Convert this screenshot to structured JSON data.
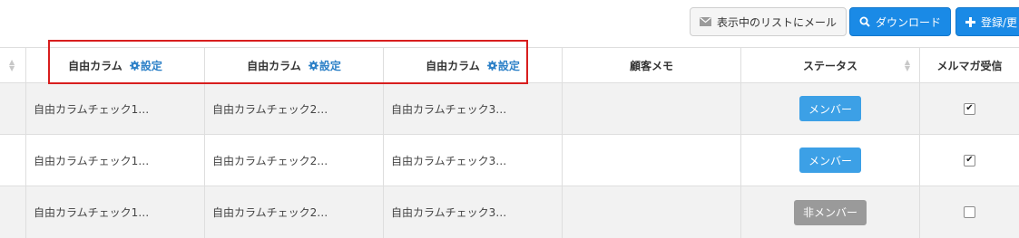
{
  "toolbar": {
    "mail_label": "表示中のリストにメール",
    "download_label": "ダウンロード",
    "register_label": "登録/更"
  },
  "columns": {
    "free_col_1": "自由カラム",
    "free_col_2": "自由カラム",
    "free_col_3": "自由カラム",
    "setting_label": "設定",
    "memo": "顧客メモ",
    "status": "ステータス",
    "mailmag": "メルマガ受信"
  },
  "rows": [
    {
      "free1": "自由カラムチェック1…",
      "free2": "自由カラムチェック2…",
      "free3": "自由カラムチェック3…",
      "memo": "",
      "status": "メンバー",
      "mailmag_checked": "✔"
    },
    {
      "free1": "自由カラムチェック1…",
      "free2": "自由カラムチェック2…",
      "free3": "自由カラムチェック3…",
      "memo": "",
      "status": "メンバー",
      "mailmag_checked": "✔"
    },
    {
      "free1": "自由カラムチェック1…",
      "free2": "自由カラムチェック2…",
      "free3": "自由カラムチェック3…",
      "memo": "",
      "status": "非メンバー",
      "mailmag_checked": ""
    }
  ],
  "colors": {
    "primary": "#1a8ae6",
    "member": "#3ca0e6",
    "nonmember": "#9a9a9a",
    "highlight": "#d81e1e",
    "link": "#2f82c8"
  },
  "icons": {
    "mail": "envelope-icon",
    "download": "search-icon",
    "register": "plus-icon",
    "setting": "gear-icon",
    "sort": "sort-icon"
  }
}
